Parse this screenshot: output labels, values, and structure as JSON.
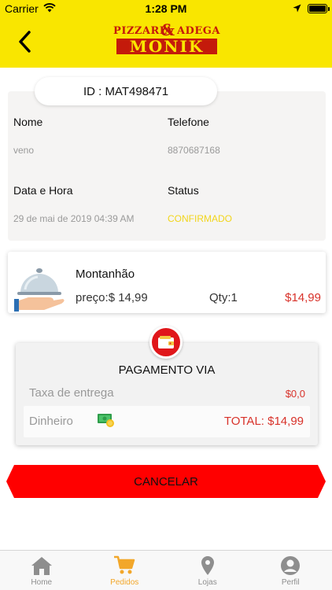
{
  "status_bar": {
    "carrier": "Carrier",
    "time": "1:28 PM"
  },
  "header": {
    "logo_top": "PIZZARIA     ADEGA",
    "logo_amp": "&",
    "logo_main": "MONIK"
  },
  "order": {
    "id_label": "ID : MAT498471",
    "name_label": "Nome",
    "name_value": "veno",
    "phone_label": "Telefone",
    "phone_value": "8870687168",
    "datetime_label": "Data e Hora",
    "datetime_value": "29 de mai de 2019 04:39 AM",
    "status_label": "Status",
    "status_value": "CONFIRMADO"
  },
  "item": {
    "name": "Montanhão",
    "price": "preço:$ 14,99",
    "qty": "Qty:1",
    "total": "$14,99"
  },
  "payment": {
    "title": "PAGAMENTO VIA",
    "fee_label": "Taxa de entrega",
    "fee_value": "$0,0",
    "method_label": "Dinheiro",
    "total": "TOTAL: $14,99"
  },
  "actions": {
    "cancel_label": "CANCELAR"
  },
  "tabs": [
    {
      "label": "Home",
      "icon": "home-icon"
    },
    {
      "label": "Pedidos",
      "icon": "cart-icon"
    },
    {
      "label": "Lojas",
      "icon": "location-pin-icon"
    },
    {
      "label": "Perfil",
      "icon": "profile-icon"
    }
  ],
  "colors": {
    "brand_yellow": "#f9e600",
    "brand_red": "#c41a0b",
    "price_red": "#d8322a",
    "status_yellow": "#f2d51b",
    "active_tab": "#f2a72a"
  }
}
